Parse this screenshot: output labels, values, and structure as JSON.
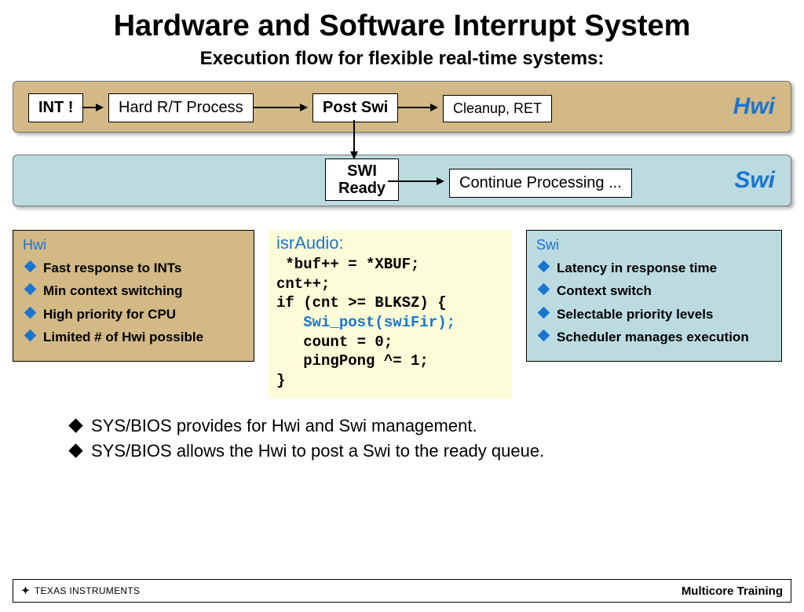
{
  "title": "Hardware and Software Interrupt System",
  "subtitle": "Execution flow for flexible real-time systems:",
  "hwi_lane": {
    "label": "Hwi",
    "nodes": {
      "int": "INT !",
      "hard": "Hard R/T Process",
      "post": "Post Swi",
      "cleanup": "Cleanup, RET"
    }
  },
  "swi_lane": {
    "label": "Swi",
    "nodes": {
      "ready": "SWI\nReady",
      "continue": "Continue Processing ..."
    }
  },
  "hwi_panel": {
    "title": "Hwi",
    "items": [
      "Fast response to INTs",
      "Min context switching",
      "High priority for CPU",
      "Limited # of Hwi possible"
    ]
  },
  "swi_panel": {
    "title": "Swi",
    "items": [
      "Latency in response time",
      "Context switch",
      "Selectable priority levels",
      "Scheduler manages execution"
    ]
  },
  "code": {
    "title": "isrAudio:",
    "line1": " *buf++ = *XBUF;",
    "line2": "cnt++;",
    "line3": "if (cnt >= BLKSZ) {",
    "line4": "   Swi_post(swiFir);",
    "line5": "   count = 0;",
    "line6": "   pingPong ^= 1;",
    "line7": "}"
  },
  "bottom_bullets": [
    "SYS/BIOS provides for Hwi and Swi management.",
    "SYS/BIOS allows the Hwi to post a Swi to the ready queue."
  ],
  "footer": {
    "left_symbol": "✦",
    "left_text": "TEXAS INSTRUMENTS",
    "right": "Multicore Training"
  }
}
